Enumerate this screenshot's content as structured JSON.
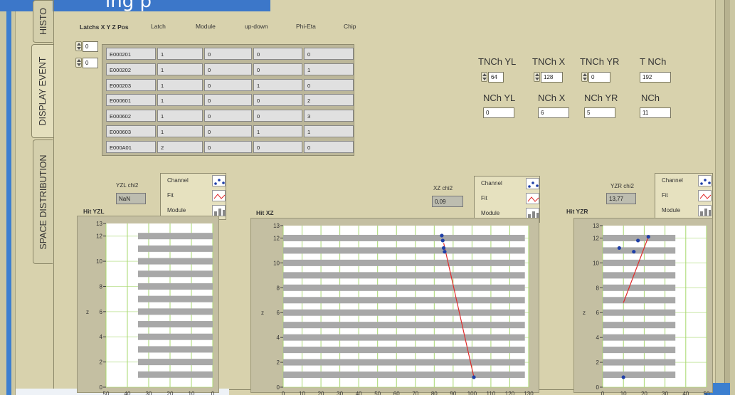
{
  "header": {
    "banner_text": "ing p"
  },
  "tabs": [
    {
      "label": "HISTO",
      "active": false
    },
    {
      "label": "DISPLAY EVENT",
      "active": true
    },
    {
      "label": "SPACE DISTRIBUTION",
      "active": false
    }
  ],
  "latch_section": {
    "title": "Latchs X Y Z Pos",
    "columns": [
      "Latch",
      "Module",
      "up-down",
      "Phi-Eta",
      "Chip"
    ],
    "spin_values": [
      "0",
      "0"
    ],
    "rows": [
      [
        "E000201",
        "1",
        "0",
        "0",
        "0"
      ],
      [
        "E000202",
        "1",
        "0",
        "0",
        "1"
      ],
      [
        "E000203",
        "1",
        "0",
        "1",
        "0"
      ],
      [
        "E000601",
        "1",
        "0",
        "0",
        "2"
      ],
      [
        "E000602",
        "1",
        "0",
        "0",
        "3"
      ],
      [
        "E000603",
        "1",
        "0",
        "1",
        "1"
      ],
      [
        "E000A01",
        "2",
        "0",
        "0",
        "0"
      ]
    ]
  },
  "counters": {
    "tnch_yl": {
      "label": "TNCh YL",
      "value": "64"
    },
    "tnch_x": {
      "label": "TNCh X",
      "value": "128"
    },
    "tnch_yr": {
      "label": "TNCh YR",
      "value": "0"
    },
    "t_nch": {
      "label": "T NCh",
      "value": "192"
    },
    "nch_yl": {
      "label": "NCh YL",
      "value": "0"
    },
    "nch_x": {
      "label": "NCh X",
      "value": "6"
    },
    "nch_yr": {
      "label": "NCh YR",
      "value": "5"
    },
    "nch": {
      "label": "NCh",
      "value": "11"
    }
  },
  "legend_labels": {
    "channel": "Channel",
    "fit": "Fit",
    "module": "Module"
  },
  "colors": {
    "point": "#1f3fa8",
    "fit_line": "#e02a2a",
    "strip": "#a8a8a8",
    "grid": "#a7d86e",
    "plot_bg": "#ffffff"
  },
  "plots": {
    "yzl": {
      "title": "Hit YZL",
      "chi_label": "YZL chi2",
      "chi_value": "NaN"
    },
    "xz": {
      "title": "Hit XZ",
      "chi_label": "XZ chi2",
      "chi_value": "0,09"
    },
    "yzr": {
      "title": "Hit YZR",
      "chi_label": "YZR chi2",
      "chi_value": "13,77"
    }
  },
  "chart_data": [
    {
      "type": "scatter",
      "title": "Hit YZL",
      "ylabel": "z",
      "xlim": [
        50,
        0
      ],
      "ylim": [
        0,
        13
      ],
      "x_ticks": [
        "50",
        "40",
        "30",
        "20",
        "10",
        "0"
      ],
      "y_ticks": [
        "0",
        "2",
        "4",
        "6",
        "8",
        "10",
        "12",
        "13"
      ],
      "strip_levels": [
        1,
        2,
        3,
        4,
        5,
        6,
        7,
        8,
        9,
        10,
        11,
        12
      ],
      "strip_range": [
        35,
        0
      ],
      "points": [],
      "fit_line": []
    },
    {
      "type": "scatter",
      "title": "Hit XZ",
      "ylabel": "z",
      "xlim": [
        0,
        130
      ],
      "ylim": [
        0,
        13
      ],
      "x_ticks": [
        "0",
        "10",
        "20",
        "30",
        "40",
        "50",
        "60",
        "70",
        "80",
        "90",
        "100",
        "110",
        "120",
        "130"
      ],
      "y_ticks": [
        "0",
        "2",
        "4",
        "6",
        "8",
        "10",
        "12",
        "13"
      ],
      "strip_levels": [
        1,
        2,
        3,
        4,
        5,
        6,
        7,
        8,
        9,
        10,
        11,
        12
      ],
      "strip_range": [
        0,
        128
      ],
      "points": [
        [
          84,
          12.2
        ],
        [
          84.5,
          11.8
        ],
        [
          85,
          11.2
        ],
        [
          85.5,
          10.9
        ],
        [
          101,
          0.8
        ]
      ],
      "fit_line": [
        [
          85,
          11.6
        ],
        [
          101,
          0.8
        ]
      ]
    },
    {
      "type": "scatter",
      "title": "Hit YZR",
      "ylabel": "z",
      "xlim": [
        0,
        50
      ],
      "ylim": [
        0,
        13
      ],
      "x_ticks": [
        "0",
        "10",
        "20",
        "30",
        "40",
        "50"
      ],
      "y_ticks": [
        "0",
        "2",
        "4",
        "6",
        "8",
        "10",
        "12",
        "13"
      ],
      "strip_levels": [
        1,
        2,
        3,
        4,
        5,
        6,
        7,
        8,
        9,
        10,
        11,
        12
      ],
      "strip_range": [
        0,
        35
      ],
      "points": [
        [
          8,
          11.2
        ],
        [
          15,
          10.9
        ],
        [
          17,
          11.8
        ],
        [
          22,
          12.1
        ],
        [
          10,
          0.8
        ]
      ],
      "fit_line": [
        [
          10,
          6.8
        ],
        [
          22,
          12.1
        ]
      ]
    }
  ]
}
